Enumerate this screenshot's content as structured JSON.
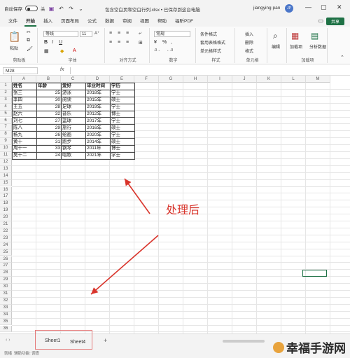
{
  "titlebar": {
    "autosave_label": "自动保存",
    "autosave_state": "关",
    "file_title": "包含空白页和空白行列.xlsx • 已保存到这台电脑",
    "user_name": "jiangying pan",
    "user_initials": "JP"
  },
  "menu": {
    "tabs": [
      "文件",
      "开始",
      "插入",
      "页面布局",
      "公式",
      "数据",
      "审阅",
      "视图",
      "帮助",
      "福昕PDF"
    ],
    "active": "开始",
    "share_label": "共享"
  },
  "ribbon": {
    "groups": [
      "剪贴板",
      "字体",
      "对齐方式",
      "数字",
      "样式",
      "单元格",
      "编辑",
      "加载项"
    ],
    "paste_label": "粘贴",
    "font_name": "等线",
    "font_size": "11",
    "number_format": "常规",
    "conditional_format": "条件格式",
    "table_format": "套用表格格式",
    "cell_styles": "单元格样式",
    "insert": "插入",
    "delete": "删除",
    "format": "格式",
    "edit_label": "编辑",
    "addins_label": "加载项",
    "analyze_label": "分析数据"
  },
  "formula": {
    "namebox": "M28",
    "fx": "fx"
  },
  "grid": {
    "columns": [
      "A",
      "B",
      "C",
      "D",
      "E",
      "F",
      "G",
      "H",
      "I",
      "J",
      "K",
      "L",
      "M"
    ],
    "rows": [
      "1",
      "2",
      "3",
      "4",
      "5",
      "6",
      "7",
      "8",
      "9",
      "10",
      "11",
      "12",
      "13",
      "14",
      "15",
      "16",
      "17",
      "18",
      "19",
      "20",
      "21",
      "22",
      "23",
      "24",
      "25",
      "26",
      "27",
      "28",
      "29",
      "30",
      "31",
      "32",
      "33",
      "34",
      "35",
      "36"
    ]
  },
  "table": {
    "headers": [
      "姓名",
      "年龄",
      "爱好",
      "毕业时间",
      "学历"
    ],
    "rows": [
      [
        "张三",
        "25",
        "游泳",
        "2018年",
        "学士"
      ],
      [
        "李四",
        "30",
        "阅读",
        "2015年",
        "硕士"
      ],
      [
        "王五",
        "28",
        "足球",
        "2019年",
        "学士"
      ],
      [
        "赵六",
        "32",
        "音乐",
        "2012年",
        "博士"
      ],
      [
        "刘七",
        "27",
        "篮球",
        "2017年",
        "学士"
      ],
      [
        "陈八",
        "29",
        "旅行",
        "2016年",
        "硕士"
      ],
      [
        "杨九",
        "26",
        "绘画",
        "2020年",
        "学士"
      ],
      [
        "黄十",
        "31",
        "跑步",
        "2014年",
        "硕士"
      ],
      [
        "周十一",
        "33",
        "钢琴",
        "2011年",
        "博士"
      ],
      [
        "吴十二",
        "24",
        "唱歌",
        "2021年",
        "学士"
      ]
    ]
  },
  "annotation": {
    "label": "处理后",
    "color": "#d9342b"
  },
  "sheets": {
    "tabs": [
      "Sheet1",
      "Sheet4"
    ],
    "add": "+"
  },
  "status": {
    "ready": "就绪",
    "accessibility": "辅助功能: 调查"
  },
  "watermark": "幸福手游网",
  "colors": {
    "accent": "#1e7145",
    "annotation": "#d9342b",
    "highlight_box": "#e47a7a"
  }
}
